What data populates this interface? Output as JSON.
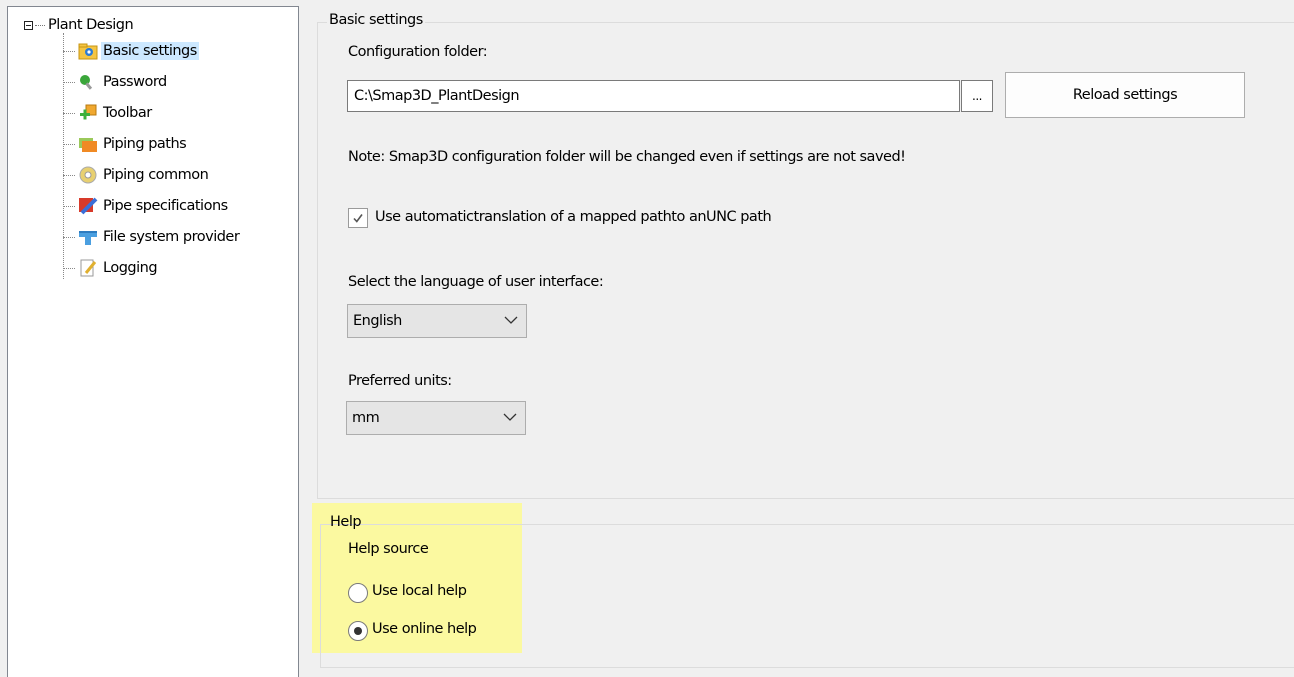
{
  "tree": {
    "root_label": "Plant Design",
    "items": [
      {
        "label": "Basic settings",
        "icon": "gear-folder-icon",
        "selected": true
      },
      {
        "label": "Password",
        "icon": "key-icon"
      },
      {
        "label": "Toolbar",
        "icon": "toolbar-plus-icon"
      },
      {
        "label": "Piping paths",
        "icon": "folder-icon"
      },
      {
        "label": "Piping common",
        "icon": "disc-icon"
      },
      {
        "label": "Pipe specifications",
        "icon": "spec-icon"
      },
      {
        "label": "File system provider",
        "icon": "file-system-icon"
      },
      {
        "label": "Logging",
        "icon": "log-icon"
      }
    ]
  },
  "basic_settings": {
    "group_title": "Basic settings",
    "config_folder_label": "Configuration folder:",
    "config_folder_value": "C:\\Smap3D_PlantDesign",
    "browse_label": "...",
    "reload_label": "Reload settings",
    "note": "Note: Smap3D configuration folder will be changed even if settings are not saved!",
    "unc_checkbox_label": "Use automatictranslation of a mapped pathto anUNC path",
    "unc_checked": true,
    "language_label": "Select the language of user interface:",
    "language_value": "English",
    "units_label": "Preferred units:",
    "units_value": "mm"
  },
  "help": {
    "group_title": "Help",
    "source_label": "Help source",
    "local_label": "Use local help",
    "online_label": "Use online help",
    "selected": "online"
  },
  "colors": {
    "selection": "#cce8ff",
    "highlight": "#fcfa8e"
  }
}
